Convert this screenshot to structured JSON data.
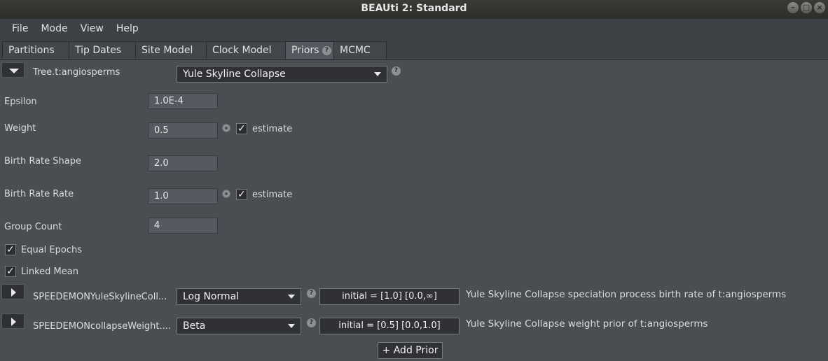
{
  "window": {
    "title": "BEAUti 2: Standard"
  },
  "menu": [
    "File",
    "Mode",
    "View",
    "Help"
  ],
  "tabs": [
    "Partitions",
    "Tip Dates",
    "Site Model",
    "Clock Model",
    "Priors",
    "MCMC"
  ],
  "tree": {
    "label": "Tree.t:angiosperms",
    "model": "Yule Skyline Collapse"
  },
  "params": {
    "epsilon_label": "Epsilon",
    "epsilon": "1.0E-4",
    "weight_label": "Weight",
    "weight": "0.5",
    "brs_label": "Birth Rate Shape",
    "brs": "2.0",
    "brr_label": "Birth Rate Rate",
    "brr": "1.0",
    "gc_label": "Group Count",
    "gc": "4",
    "estimate": "estimate"
  },
  "checks": {
    "equal_epochs": "Equal Epochs",
    "linked_mean": "Linked Mean"
  },
  "priors": [
    {
      "name": "SPEEDEMONYuleSkylineColl...",
      "dist": "Log Normal",
      "initial": "initial = [1.0] [0.0,∞]",
      "desc": "Yule Skyline Collapse speciation process birth rate of t:angiosperms"
    },
    {
      "name": "SPEEDEMONcollapseWeight....",
      "dist": "Beta",
      "initial": "initial = [0.5] [0.0,1.0]",
      "desc": "Yule Skyline Collapse weight prior of t:angiosperms"
    }
  ],
  "add_prior": "+ Add Prior"
}
